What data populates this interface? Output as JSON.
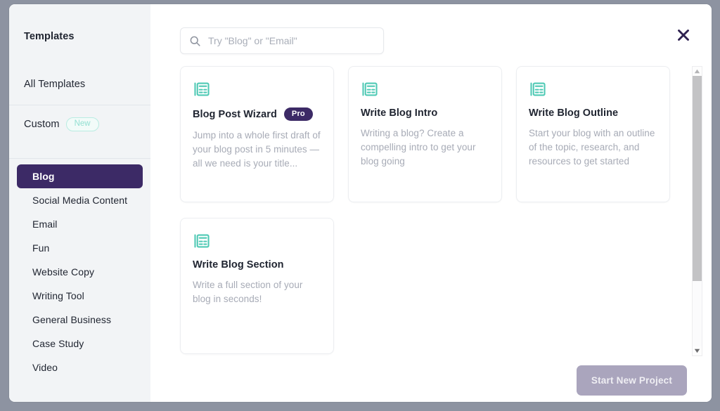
{
  "sidebar": {
    "heading": "Templates",
    "all_templates": "All Templates",
    "custom_label": "Custom",
    "custom_badge": "New",
    "active_item": "Blog",
    "items": [
      {
        "label": "Blog",
        "active": true
      },
      {
        "label": "Social Media Content",
        "active": false
      },
      {
        "label": "Email",
        "active": false
      },
      {
        "label": "Fun",
        "active": false
      },
      {
        "label": "Website Copy",
        "active": false
      },
      {
        "label": "Writing Tool",
        "active": false
      },
      {
        "label": "General Business",
        "active": false
      },
      {
        "label": "Case Study",
        "active": false
      },
      {
        "label": "Video",
        "active": false
      }
    ]
  },
  "search": {
    "placeholder": "Try \"Blog\" or \"Email\"",
    "value": "",
    "icon": "search-icon"
  },
  "close": {
    "icon": "close-icon"
  },
  "cards": [
    {
      "icon": "article-icon",
      "title": "Blog Post Wizard",
      "badge": "Pro",
      "description": "Jump into a whole first draft of your blog post in 5 minutes — all we need is your title..."
    },
    {
      "icon": "article-icon",
      "title": "Write Blog Intro",
      "badge": "",
      "description": "Writing a blog? Create a compelling intro to get your blog going"
    },
    {
      "icon": "article-icon",
      "title": "Write Blog Outline",
      "badge": "",
      "description": "Start your blog with an outline of the topic, research, and resources to get started"
    },
    {
      "icon": "article-icon",
      "title": "Write Blog Section",
      "badge": "",
      "description": "Write a full section of your blog in seconds!"
    }
  ],
  "scrollbar": {
    "up_icon": "triangle-up-icon",
    "down_icon": "triangle-down-icon"
  },
  "footer": {
    "primary_button": "Start New Project"
  },
  "colors": {
    "accent_purple": "#3c2a66",
    "teal": "#4ec9b4",
    "muted_button": "#aaa5bd",
    "sidebar_bg": "#f2f4f6",
    "window_border": "#8d93a1"
  }
}
